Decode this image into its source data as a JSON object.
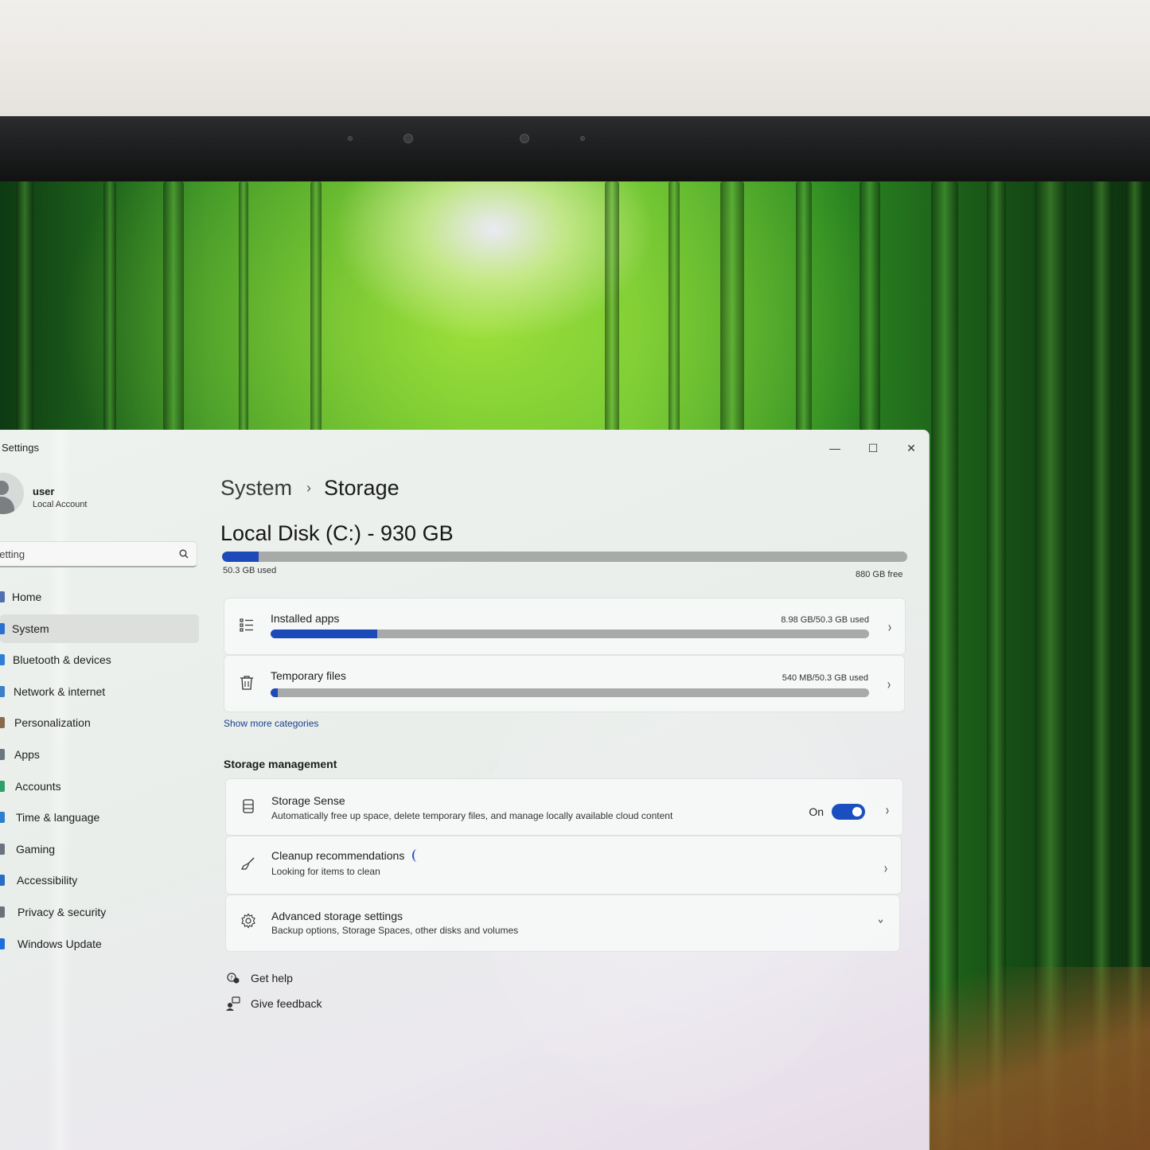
{
  "window": {
    "title": "Settings",
    "controls": {
      "minimize": "—",
      "maximize": "☐",
      "close": "✕"
    }
  },
  "user": {
    "name": "user",
    "account_type": "Local Account"
  },
  "search": {
    "placeholder": "Find a setting"
  },
  "nav": [
    {
      "label": "Home",
      "icon": "home-icon",
      "color": "#4f6fb0"
    },
    {
      "label": "System",
      "icon": "system-icon",
      "color": "#2b70d0",
      "active": true
    },
    {
      "label": "Bluetooth & devices",
      "icon": "bluetooth-icon",
      "color": "#2f7fd6"
    },
    {
      "label": "Network & internet",
      "icon": "network-icon",
      "color": "#3c80c8"
    },
    {
      "label": "Personalization",
      "icon": "brush-icon",
      "color": "#8a6a4a"
    },
    {
      "label": "Apps",
      "icon": "apps-icon",
      "color": "#6c7580"
    },
    {
      "label": "Accounts",
      "icon": "accounts-icon",
      "color": "#2fa06a"
    },
    {
      "label": "Time & language",
      "icon": "globe-icon",
      "color": "#2e7ed0"
    },
    {
      "label": "Gaming",
      "icon": "gaming-icon",
      "color": "#6b7280"
    },
    {
      "label": "Accessibility",
      "icon": "accessibility-icon",
      "color": "#2b6cc4"
    },
    {
      "label": "Privacy & security",
      "icon": "shield-icon",
      "color": "#6a7178"
    },
    {
      "label": "Windows Update",
      "icon": "update-icon",
      "color": "#1f6fd8"
    }
  ],
  "breadcrumb": {
    "parent": "System",
    "separator": "›",
    "current": "Storage"
  },
  "disk": {
    "title": "Local Disk (C:) - 930 GB",
    "used": "50.3 GB used",
    "free": "880 GB free",
    "used_fraction": 0.054
  },
  "categories": [
    {
      "title": "Installed apps",
      "usage": "8.98 GB/50.3 GB used",
      "fraction": 0.178,
      "icon": "list-icon"
    },
    {
      "title": "Temporary files",
      "usage": "540 MB/50.3 GB used",
      "fraction": 0.011,
      "icon": "trash-icon"
    }
  ],
  "show_more": "Show more categories",
  "management": {
    "heading": "Storage management",
    "storage_sense": {
      "title": "Storage Sense",
      "desc": "Automatically free up space, delete temporary files, and manage locally available cloud content",
      "toggle_label": "On",
      "toggle_on": true
    },
    "cleanup": {
      "title": "Cleanup recommendations",
      "desc": "Looking for items to clean"
    },
    "advanced": {
      "title": "Advanced storage settings",
      "desc": "Backup options, Storage Spaces, other disks and volumes"
    }
  },
  "footer": {
    "help": "Get help",
    "feedback": "Give feedback"
  },
  "colors": {
    "accent": "#1e49b8",
    "bar_track": "#a7aaa8"
  }
}
